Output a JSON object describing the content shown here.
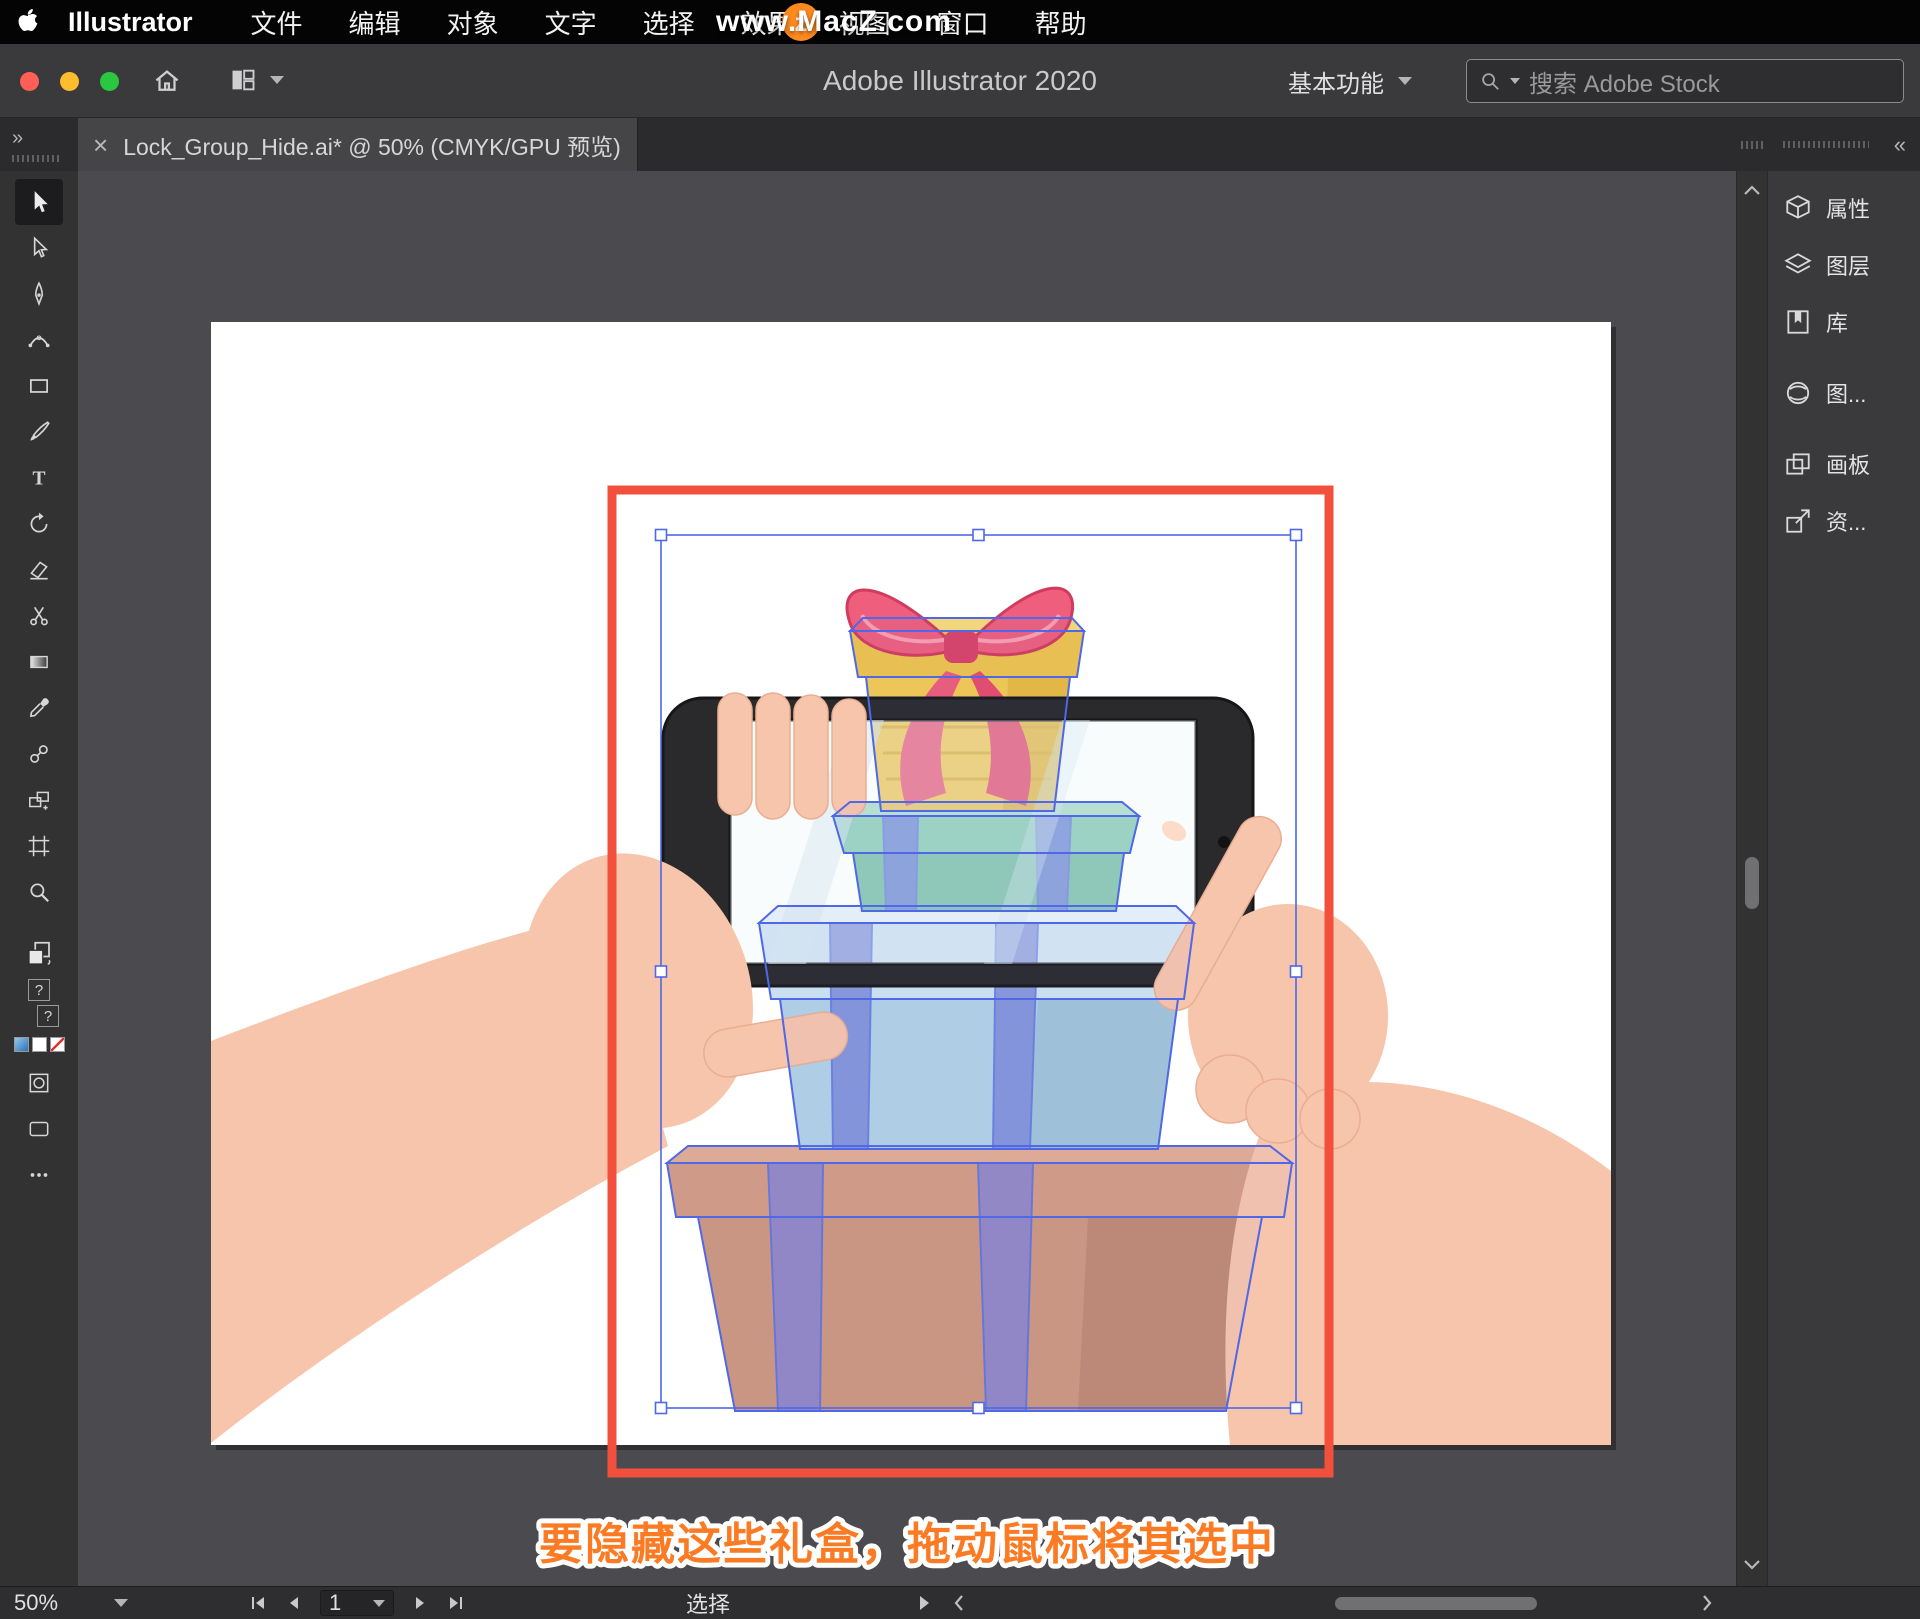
{
  "menu_bar": {
    "app_name": "Illustrator",
    "items": [
      "文件",
      "编辑",
      "对象",
      "文字",
      "选择",
      "效果",
      "视图",
      "窗口",
      "帮助"
    ],
    "watermark_text": "www.MacZ.com",
    "watermark_logo": "z"
  },
  "title_bar": {
    "title": "Adobe Illustrator 2020",
    "workspace_label": "基本功能",
    "search_placeholder": "搜索 Adobe Stock"
  },
  "tab_strip": {
    "left_expand": "»",
    "right_collapse": "«",
    "tab": {
      "close_glyph": "×",
      "label": "Lock_Group_Hide.ai* @ 50% (CMYK/GPU 预览)"
    }
  },
  "toolbar": {
    "active_tool": "selection-tool",
    "proxy_placeholder": "?",
    "tools": [
      "selection-tool",
      "direct-selection-tool",
      "pen-tool",
      "curvature-tool",
      "rectangle-tool",
      "paintbrush-tool",
      "type-tool",
      "rotate-tool",
      "eraser-tool",
      "scissors-tool",
      "gradient-tool",
      "eyedropper-tool",
      "blend-tool",
      "shape-builder-tool",
      "artboard-tool",
      "zoom-tool"
    ]
  },
  "right_panel": {
    "items": [
      {
        "icon": "properties-icon",
        "label": "属性"
      },
      {
        "icon": "layers-icon",
        "label": "图层"
      },
      {
        "icon": "libraries-icon",
        "label": "库"
      },
      {
        "icon": "graphic-icon",
        "label": "图..."
      },
      {
        "icon": "artboards-icon",
        "label": "画板"
      },
      {
        "icon": "export-icon",
        "label": "资..."
      }
    ]
  },
  "canvas": {
    "caption": "要隐藏这些礼盒，拖动鼠标将其选中"
  },
  "status_bar": {
    "zoom": "50%",
    "artboard_value": "1",
    "status_label": "选择"
  },
  "colors": {
    "annotation_red": "#F2503C",
    "selection_blue": "#4E68E8",
    "caption_orange": "#FB7B24",
    "watermark_orange": "#FF8A1E",
    "traffic_close": "#FF5F57",
    "traffic_minimize": "#FEBC2E",
    "traffic_zoom": "#29C840"
  }
}
